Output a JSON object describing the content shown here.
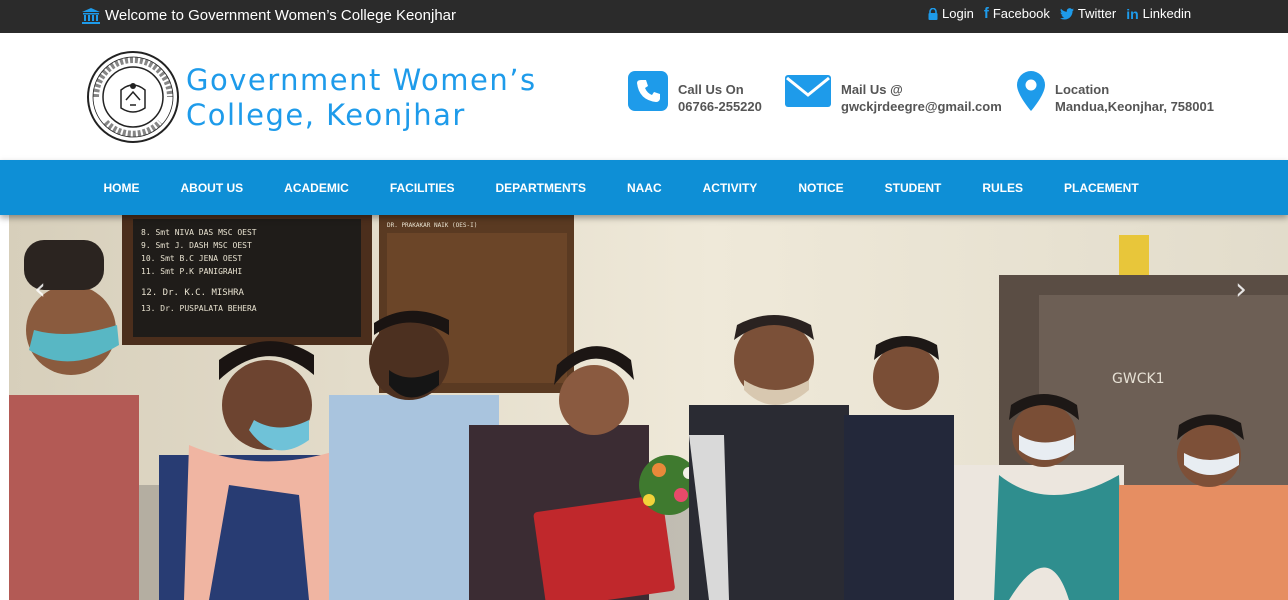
{
  "topbar": {
    "welcome": "Welcome to Government Women’s College Keonjhar",
    "links": {
      "login": "Login",
      "facebook": "Facebook",
      "twitter": "Twitter",
      "linkedin": "Linkedin"
    }
  },
  "header": {
    "title_line1": "Government Women’s",
    "title_line2": "College, Keonjhar",
    "logo_text": "GOVT. WOMEN'S COLLEGE KEONJHAR ESTD-1979",
    "call": {
      "label": "Call Us On",
      "value": "06766-255220"
    },
    "mail": {
      "label": "Mail Us @",
      "value": "gwckjrdeegre@gmail.com"
    },
    "location": {
      "label": "Location",
      "value": "Mandua,Keonjhar, 758001"
    }
  },
  "nav": [
    "HOME",
    "ABOUT US",
    "ACADEMIC",
    "FACILITIES",
    "DEPARTMENTS",
    "NAAC",
    "ACTIVITY",
    "NOTICE",
    "STUDENT",
    "RULES",
    "PLACEMENT"
  ],
  "hero": {
    "board_lines": [
      "8. Smt NIVA DAS MSC OEST",
      "9. Smt J. DASH MSC OEST",
      "10. Smt B.C JENA OEST",
      "11. Smt P.K PANIGRAHI",
      "12. Dr. K.C. MISHRA",
      "13. Dr. PUSPALATA BEHERA"
    ],
    "board_right": "DR. PRAKAKAR NAIK (OES-I)",
    "cabinet_label": "GWCK1"
  },
  "colors": {
    "accent": "#1e9bea",
    "nav": "#0e8fd6",
    "topbar": "#2b2b2b"
  },
  "icons": {
    "welcome": "bank-icon",
    "login": "lock-icon",
    "facebook": "facebook-icon",
    "twitter": "twitter-icon",
    "linkedin": "linkedin-icon",
    "call": "phone-icon",
    "mail": "envelope-icon",
    "location": "map-marker-icon",
    "prev": "chevron-left-icon",
    "next": "chevron-right-icon"
  }
}
